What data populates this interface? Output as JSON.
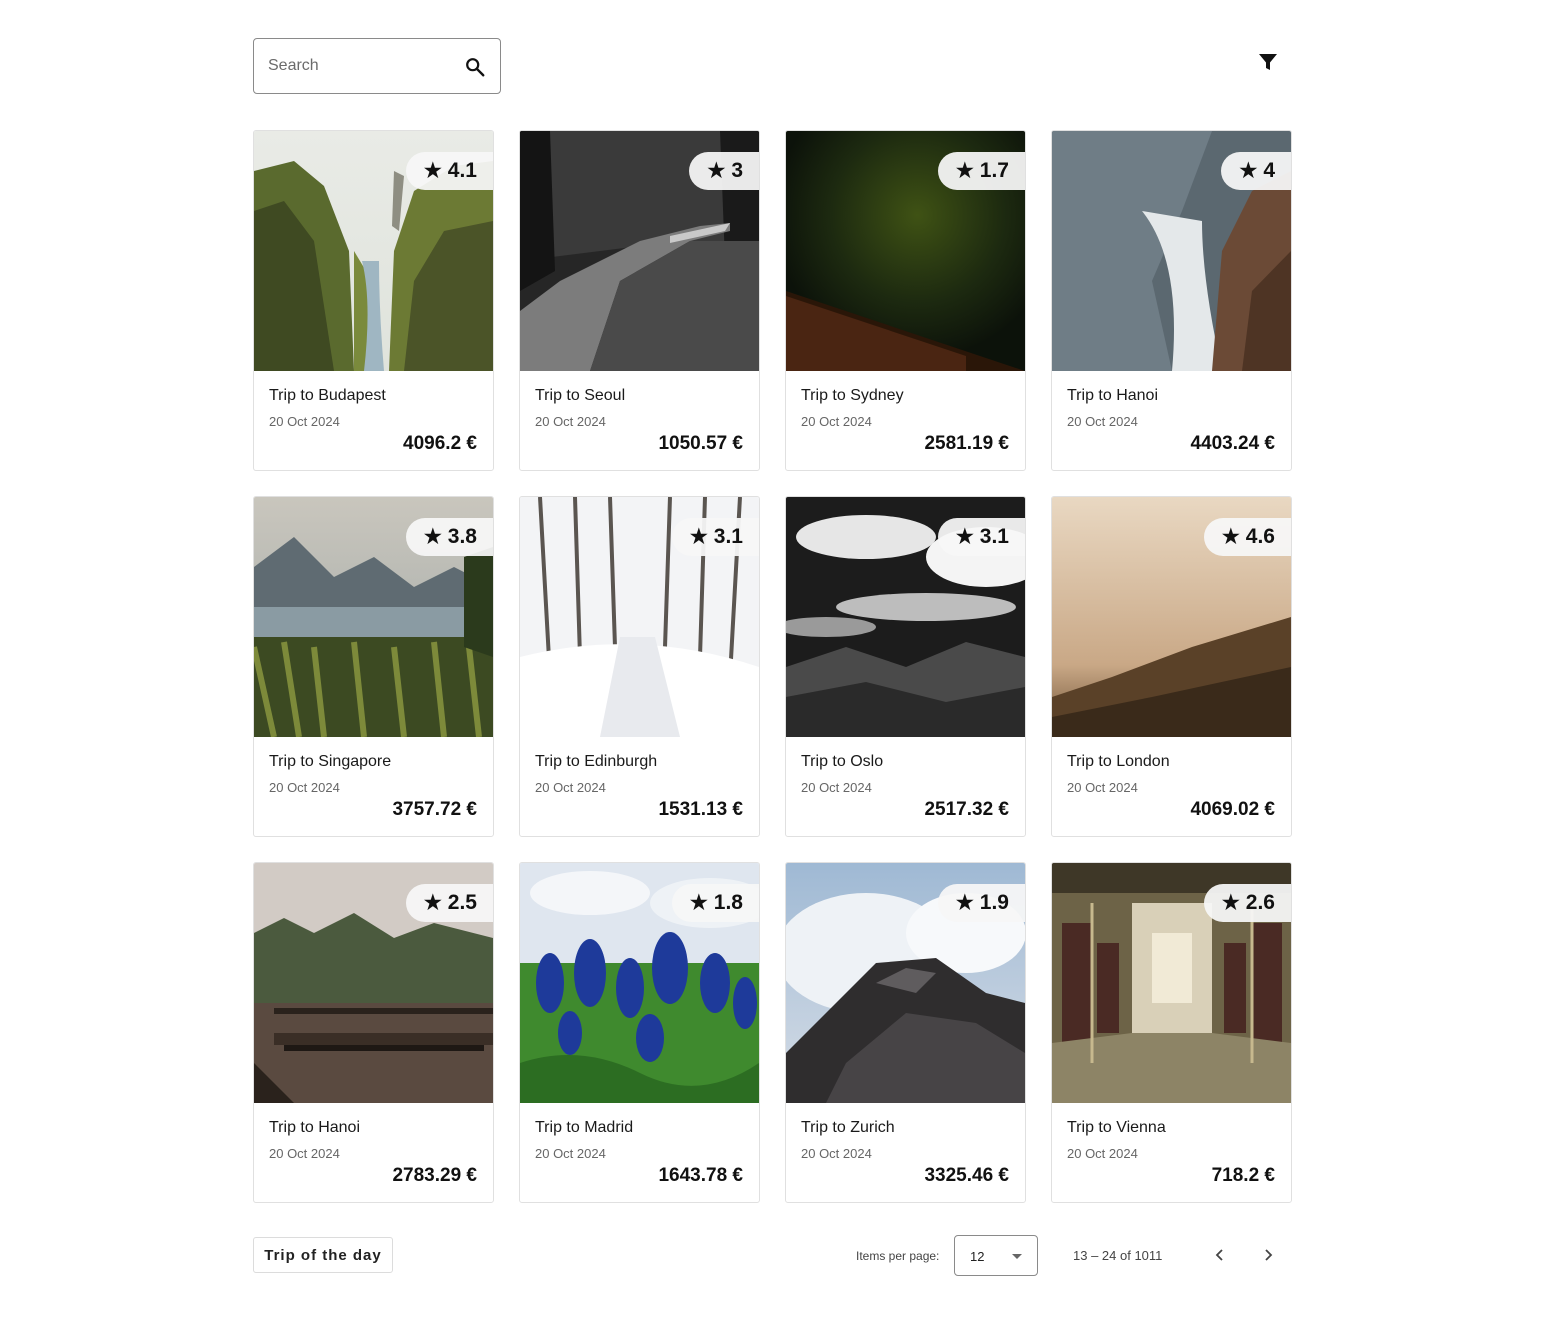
{
  "search": {
    "placeholder": "Search",
    "icon": "search-icon"
  },
  "filter": {
    "icon": "filter-icon"
  },
  "cards": [
    {
      "title": "Trip to Budapest",
      "date": "20 Oct 2024",
      "price": "4096.2 €",
      "rating": "4.1",
      "scene": "canyon"
    },
    {
      "title": "Trip to Seoul",
      "date": "20 Oct 2024",
      "price": "1050.57 €",
      "rating": "3",
      "scene": "forest-road-bw"
    },
    {
      "title": "Trip to Sydney",
      "date": "20 Oct 2024",
      "price": "2581.19 €",
      "rating": "1.7",
      "scene": "night-sky"
    },
    {
      "title": "Trip to Hanoi",
      "date": "20 Oct 2024",
      "price": "4403.24 €",
      "rating": "4",
      "scene": "sea-waves"
    },
    {
      "title": "Trip to Singapore",
      "date": "20 Oct 2024",
      "price": "3757.72 €",
      "rating": "3.8",
      "scene": "lake-reeds"
    },
    {
      "title": "Trip to Edinburgh",
      "date": "20 Oct 2024",
      "price": "1531.13 €",
      "rating": "3.1",
      "scene": "snow-path"
    },
    {
      "title": "Trip to Oslo",
      "date": "20 Oct 2024",
      "price": "2517.32 €",
      "rating": "3.1",
      "scene": "clouds-bw"
    },
    {
      "title": "Trip to London",
      "date": "20 Oct 2024",
      "price": "4069.02 €",
      "rating": "4.6",
      "scene": "misty-hills"
    },
    {
      "title": "Trip to Hanoi",
      "date": "20 Oct 2024",
      "price": "2783.29 €",
      "rating": "2.5",
      "scene": "foggy-bridge"
    },
    {
      "title": "Trip to Madrid",
      "date": "20 Oct 2024",
      "price": "1643.78 €",
      "rating": "1.8",
      "scene": "bluebonnets"
    },
    {
      "title": "Trip to Zurich",
      "date": "20 Oct 2024",
      "price": "3325.46 €",
      "rating": "1.9",
      "scene": "rock-splash"
    },
    {
      "title": "Trip to Vienna",
      "date": "20 Oct 2024",
      "price": "718.2 €",
      "rating": "2.6",
      "scene": "tram-interior"
    }
  ],
  "footer": {
    "trip_of_day_label": "Trip of the day",
    "items_per_page_label": "Items per page:",
    "items_per_page_value": "12",
    "range_label": "13 – 24 of 1011",
    "prev_icon": "chevron-left-icon",
    "next_icon": "chevron-right-icon"
  }
}
